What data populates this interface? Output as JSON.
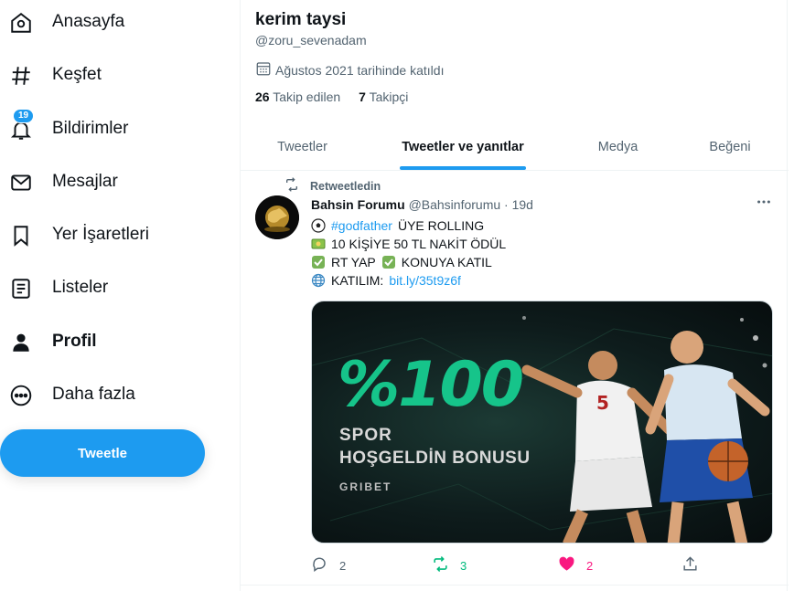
{
  "sidebar": {
    "items": [
      {
        "label": "Anasayfa",
        "icon": "home-icon"
      },
      {
        "label": "Keşfet",
        "icon": "hashtag-icon"
      },
      {
        "label": "Bildirimler",
        "icon": "bell-icon",
        "badge": "19"
      },
      {
        "label": "Mesajlar",
        "icon": "mail-icon"
      },
      {
        "label": "Yer İşaretleri",
        "icon": "bookmark-icon"
      },
      {
        "label": "Listeler",
        "icon": "list-icon"
      },
      {
        "label": "Profil",
        "icon": "person-icon",
        "active": true
      },
      {
        "label": "Daha fazla",
        "icon": "more-circle-icon"
      }
    ],
    "tweet_button": "Tweetle"
  },
  "profile": {
    "name": "kerim taysi",
    "handle": "@zoru_sevenadam",
    "joined": "Ağustos 2021 tarihinde katıldı",
    "following_count": "26",
    "following_label": "Takip edilen",
    "followers_count": "7",
    "followers_label": "Takipçi"
  },
  "tabs": [
    {
      "label": "Tweetler"
    },
    {
      "label": "Tweetler ve yanıtlar",
      "active": true
    },
    {
      "label": "Medya"
    },
    {
      "label": "Beğeni"
    }
  ],
  "tweet": {
    "retweet_label": "Retweetledin",
    "author_name": "Bahsin Forumu",
    "author_handle": "@Bahsinforumu",
    "separator": "·",
    "time": "19d",
    "line1_hashtag": "#godfather",
    "line1_text": "ÜYE ROLLING",
    "line2_text": "10 KİŞİYE 50 TL NAKİT ÖDÜL",
    "line3_text_a": "RT YAP",
    "line3_text_b": "KONUYA KATIL",
    "line4_text": "KATILIM:",
    "line4_link": "bit.ly/35t9z6f",
    "media": {
      "big": "%100",
      "line1": "SPOR",
      "line2": "HOŞGELDİN BONUSU",
      "brand": "GRIBET"
    },
    "replies": "2",
    "retweets": "3",
    "likes": "2"
  },
  "colors": {
    "accent": "#1d9bf0",
    "retweet_green": "#00ba7c",
    "like_pink": "#f91880",
    "muted_text": "#536471",
    "promo_green": "#16c48a"
  }
}
